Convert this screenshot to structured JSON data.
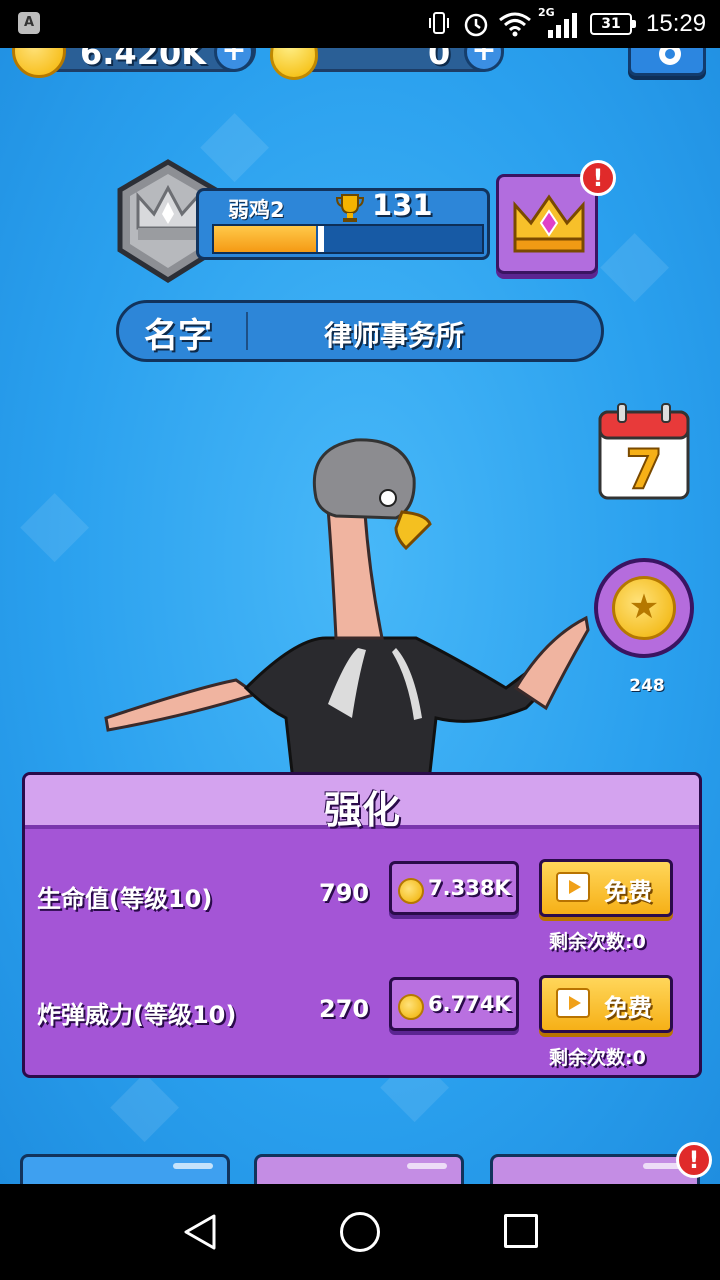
{
  "status_bar": {
    "app_icon_letter": "A",
    "network": "2G",
    "battery": "31",
    "time": "15:29"
  },
  "currency": {
    "gold_value": "6.420K",
    "gem_value": "0",
    "plus_symbol": "+"
  },
  "profile": {
    "rank_name": "弱鸡2",
    "trophies": "131",
    "rank_progress": 0.38,
    "name_label": "名字",
    "name_value": "律师事务所",
    "alert_symbol": "!"
  },
  "side": {
    "calendar_day": "7",
    "coin_count": "248"
  },
  "upgrade": {
    "title": "强化",
    "rows": [
      {
        "label": "生命值(等级10)",
        "value": "790",
        "cost": "7.338K",
        "free_label": "免费",
        "remaining": "剩余次数:0"
      },
      {
        "label": "炸弹威力(等级10)",
        "value": "270",
        "cost": "6.774K",
        "free_label": "免费",
        "remaining": "剩余次数:0"
      }
    ]
  },
  "bottom_tabs": [
    {
      "label": ""
    },
    {
      "label": ""
    },
    {
      "label": ""
    }
  ],
  "colors": {
    "background_blue": "#2aa0ee",
    "panel_purple": "#a455d6",
    "gold": "#f5b400",
    "alert_red": "#e02a2a"
  }
}
